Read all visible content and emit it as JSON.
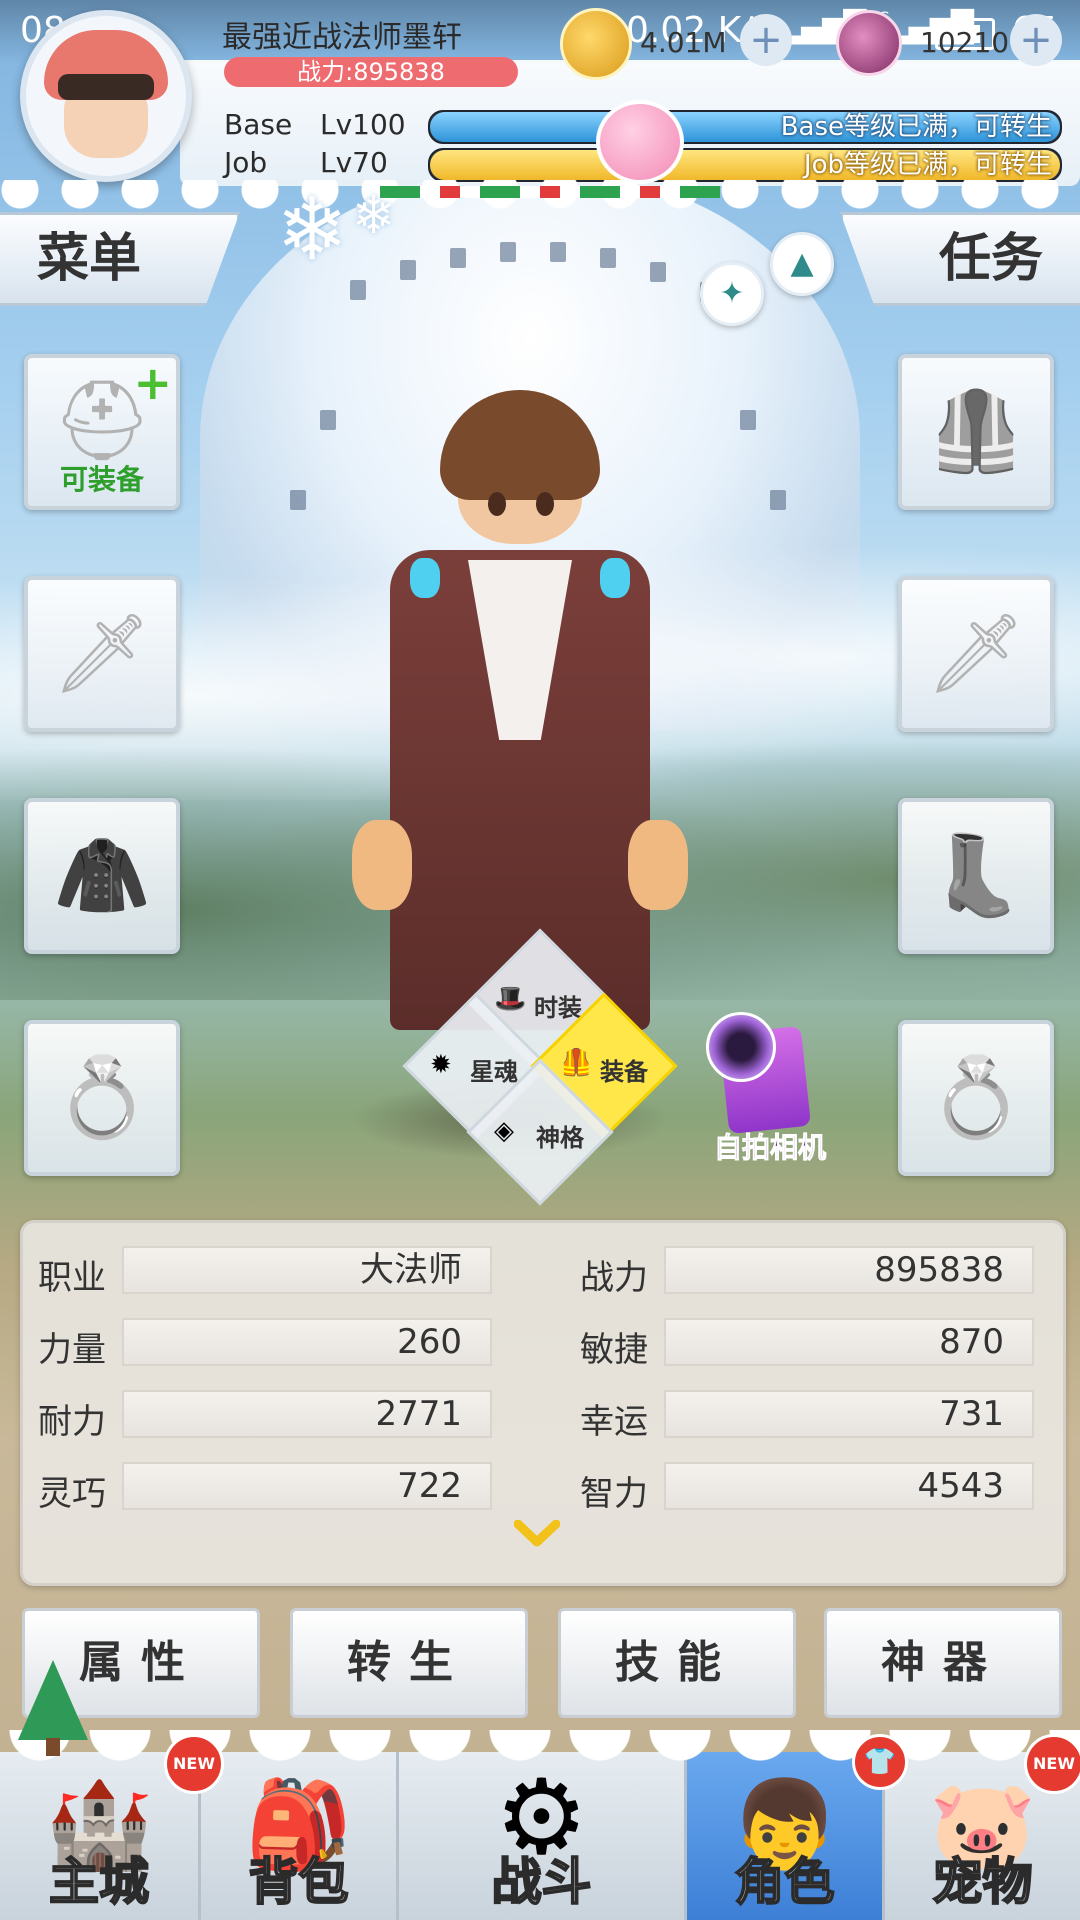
{
  "status_bar": {
    "time": "08:17",
    "net_speed": "0.02 K/s",
    "signal": "4G",
    "battery": "65"
  },
  "player": {
    "name": "最强近战法师墨轩",
    "power_pill": "战力:895838",
    "base_label": "Base",
    "base_level": "Lv100",
    "base_bar_text": "Base等级已满，可转生",
    "base_progress": 1.0,
    "job_label": "Job",
    "job_level": "Lv70",
    "job_bar_text": "Job等级已满，可转生",
    "job_progress": 1.0
  },
  "resources": {
    "coin_value": "4.01M",
    "gem_value": "10210"
  },
  "side_tabs": {
    "menu": "菜单",
    "quest": "任务"
  },
  "equipment": {
    "left_slots": [
      {
        "name": "hat-slot",
        "icon": "hat-icon",
        "label": "可装备"
      },
      {
        "name": "weapon-slot-left",
        "icon": "sword-icon"
      },
      {
        "name": "cloak-slot",
        "icon": "cloak-icon"
      },
      {
        "name": "ring-slot-left",
        "icon": "ring-icon"
      }
    ],
    "right_slots": [
      {
        "name": "armor-slot",
        "icon": "armor-icon"
      },
      {
        "name": "weapon-slot-right",
        "icon": "sword-icon"
      },
      {
        "name": "boots-slot",
        "icon": "boots-icon"
      },
      {
        "name": "ring-slot-right",
        "icon": "ring-icon"
      }
    ]
  },
  "radial_menu": {
    "fashion": "时装",
    "star_soul": "星魂",
    "equip": "装备",
    "divinity": "神格",
    "active": "equip"
  },
  "camera": {
    "label": "自拍相机"
  },
  "stats": {
    "left": [
      {
        "label": "职业",
        "value": "大法师"
      },
      {
        "label": "力量",
        "value": "260"
      },
      {
        "label": "耐力",
        "value": "2771"
      },
      {
        "label": "灵巧",
        "value": "722"
      }
    ],
    "right": [
      {
        "label": "战力",
        "value": "895838"
      },
      {
        "label": "敏捷",
        "value": "870"
      },
      {
        "label": "幸运",
        "value": "731"
      },
      {
        "label": "智力",
        "value": "4543"
      }
    ]
  },
  "actions": [
    "属性",
    "转生",
    "技能",
    "神器"
  ],
  "nav": {
    "items": [
      {
        "label": "主城",
        "badge": "NEW"
      },
      {
        "label": "背包",
        "badge": ""
      },
      {
        "label": "战斗",
        "badge": ""
      },
      {
        "label": "角色",
        "badge": "shirt"
      },
      {
        "label": "宠物",
        "badge": "NEW"
      }
    ],
    "active_index": 3
  },
  "colors": {
    "power_pill": "#ee6b6f",
    "base_bar": "#2e93d8",
    "job_bar": "#f0b82a",
    "active_nav": "#3d7fd6",
    "active_diamond": "#ffe74a"
  }
}
